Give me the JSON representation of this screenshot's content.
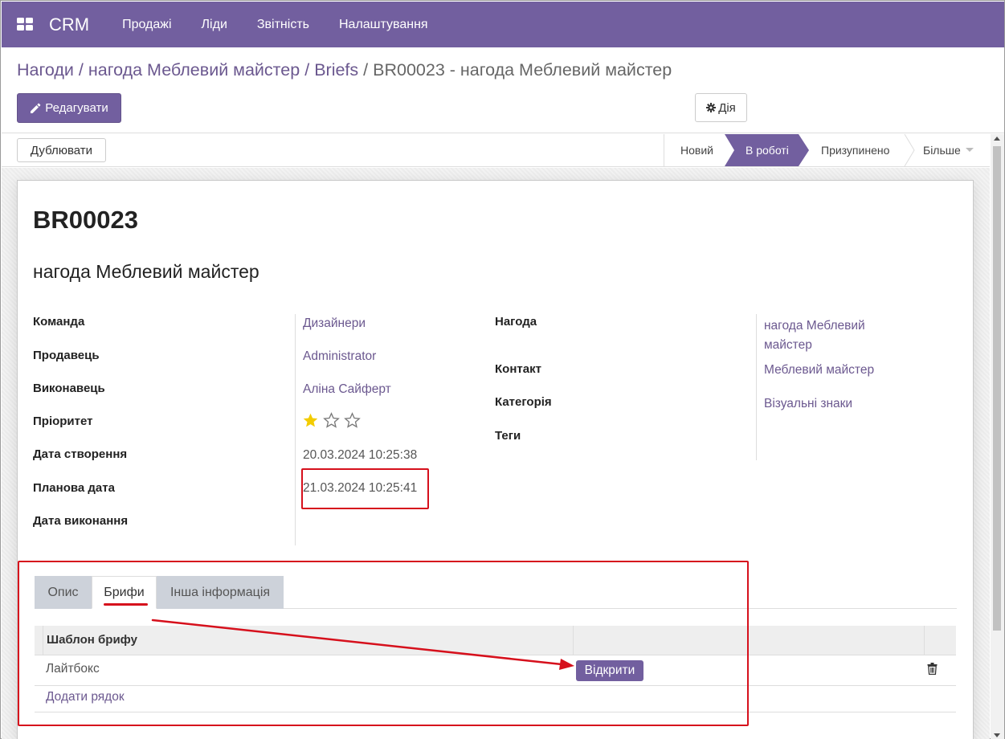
{
  "app": {
    "title": "CRM"
  },
  "nav": {
    "items": [
      "Продажі",
      "Ліди",
      "Звітність",
      "Налаштування"
    ]
  },
  "breadcrumb": {
    "items": [
      "Нагоди",
      "нагода Меблевий майстер",
      "Briefs"
    ],
    "current": "BR00023 - нагода Меблевий майстер"
  },
  "toolbar": {
    "edit_label": "Редагувати",
    "action_label": "Дія",
    "duplicate_label": "Дублювати"
  },
  "stages": {
    "new": "Новий",
    "active": "В роботі",
    "paused": "Призупинено",
    "more": "Більше"
  },
  "record": {
    "code": "BR00023",
    "name": "нагода Меблевий майстер",
    "left_fields": [
      {
        "label": "Команда",
        "value": "Дизайнери"
      },
      {
        "label": "Продавець",
        "value": "Administrator"
      },
      {
        "label": "Виконавець",
        "value": "Аліна Сайферт"
      },
      {
        "label": "Пріоритет",
        "value": ""
      },
      {
        "label": "Дата створення",
        "value": "20.03.2024 10:25:38"
      },
      {
        "label": "Планова дата",
        "value": "21.03.2024 10:25:41"
      },
      {
        "label": "Дата виконання",
        "value": ""
      }
    ],
    "right_fields": [
      {
        "label": "Нагода",
        "value_line1": "нагода Меблевий",
        "value_line2": "майстер"
      },
      {
        "label": "Контакт",
        "value": "Меблевий майстер"
      },
      {
        "label": "Категорія",
        "value": "Візуальні знаки"
      },
      {
        "label": "Теги",
        "value": ""
      }
    ],
    "priority": {
      "stars_filled": 1,
      "stars_total": 3
    }
  },
  "tabs": {
    "items": [
      "Опис",
      "Брифи",
      "Інша інформація"
    ],
    "active": "Брифи"
  },
  "briefs_table": {
    "headers": [
      "Шаблон брифу"
    ],
    "rows": [
      {
        "template": "Лайтбокс",
        "action": "Відкрити"
      }
    ],
    "add_row_label": "Додати рядок"
  },
  "colors": {
    "brand": "#725f9f",
    "annotation": "#d6101c",
    "star": "#f3cc00"
  }
}
